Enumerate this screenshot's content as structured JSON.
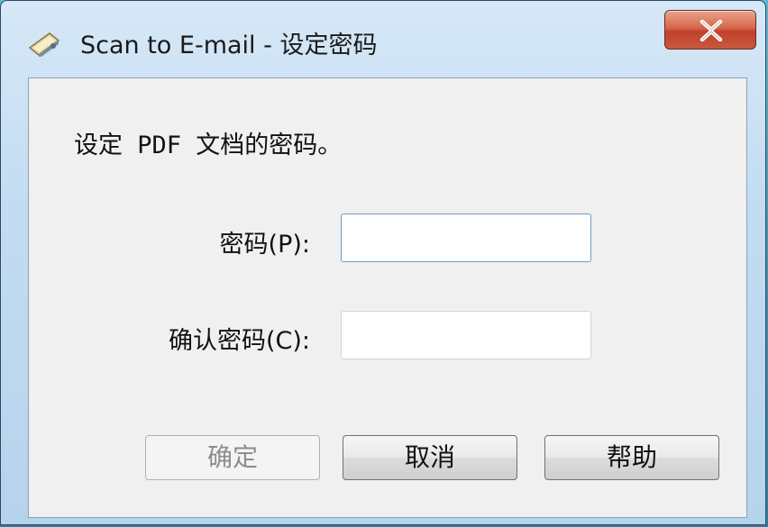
{
  "window": {
    "title": "Scan to E-mail - 设定密码",
    "close_glyph": "X",
    "title_icon": "scanner-icon"
  },
  "dialog": {
    "instruction": "设定 PDF 文档的密码。",
    "password_label": "密码(P):",
    "password_value": "",
    "confirm_label": "确认密码(C):",
    "confirm_value": ""
  },
  "buttons": {
    "ok_label": "确定",
    "ok_enabled": false,
    "cancel_label": "取消",
    "help_label": "帮助"
  },
  "colors": {
    "close_button": "#c9583f",
    "field_focus_border": "#6e9ccb",
    "disabled_text": "#8d8d8d"
  }
}
